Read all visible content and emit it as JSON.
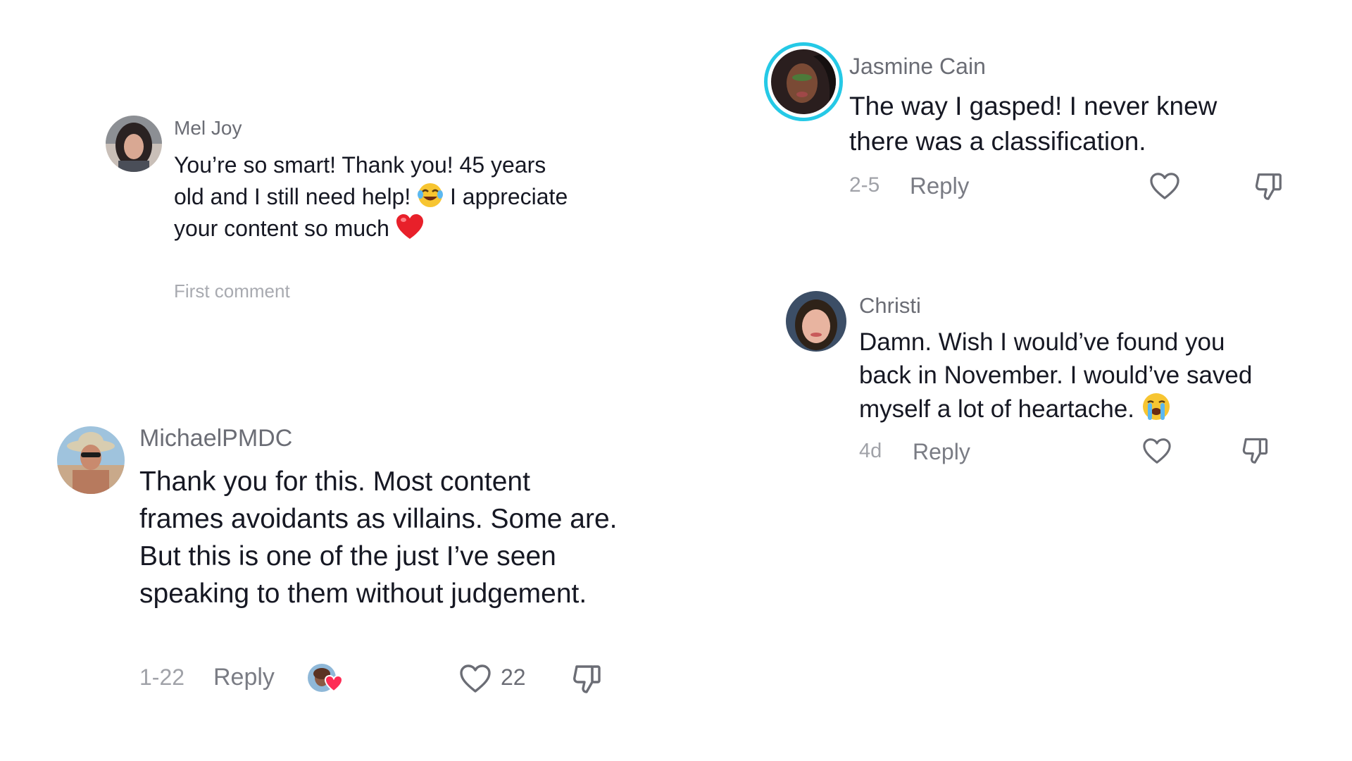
{
  "comments": [
    {
      "username": "Mel Joy",
      "text_part1": "You’re so smart! Thank you! 45 years old and I still need help!",
      "text_part2": "I appreciate your content so much",
      "emoji1": "face-with-tears-of-joy",
      "emoji2": "red-heart",
      "note": "First comment"
    },
    {
      "username": "MichaelPMDC",
      "text": "Thank you for this. Most content frames avoidants as villains. Some are. But this is one of the just I’ve seen speaking to them without judgement.",
      "date": "1-22",
      "reply_label": "Reply",
      "like_count": "22",
      "creator_liked": true
    },
    {
      "username": "Jasmine Cain",
      "text": "The way I gasped! I never knew there was a classification.",
      "date": "2-5",
      "reply_label": "Reply"
    },
    {
      "username": "Christi",
      "text": "Damn. Wish I would’ve found you back in November. I would’ve saved myself a lot of heartache.",
      "emoji": "loudly-crying-face",
      "date": "4d",
      "reply_label": "Reply"
    }
  ],
  "colors": {
    "text": "#161823",
    "username": "#6b6d75",
    "meta": "#a0a2a8",
    "story_ring": "#25c9e6",
    "heart_badge": "#fe2c55"
  },
  "icons": [
    "heart-outline-icon",
    "thumbs-down-icon"
  ]
}
